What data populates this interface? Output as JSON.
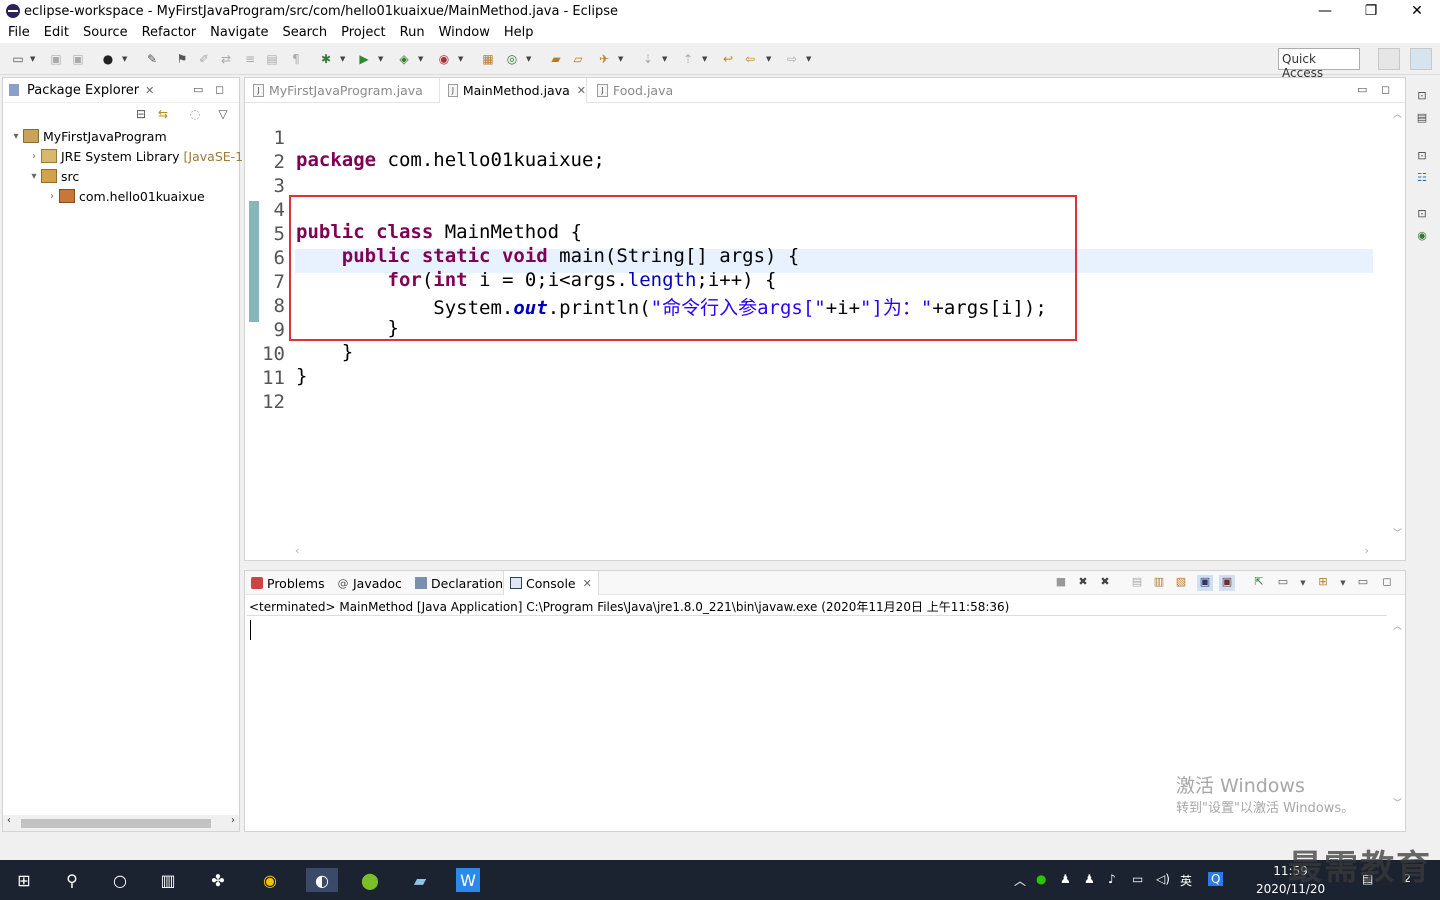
{
  "window": {
    "title": "eclipse-workspace - MyFirstJavaProgram/src/com/hello01kuaixue/MainMethod.java - Eclipse",
    "minimize": "—",
    "restore": "❐",
    "close": "✕"
  },
  "menu": [
    "File",
    "Edit",
    "Source",
    "Refactor",
    "Navigate",
    "Search",
    "Project",
    "Run",
    "Window",
    "Help"
  ],
  "toolbar": {
    "quick_access": "Quick Access"
  },
  "package_explorer": {
    "title": "Package Explorer",
    "tree": [
      {
        "label": "MyFirstJavaProgram",
        "suffix": "",
        "icon": "project-icon",
        "expanded": true
      },
      {
        "label": "JRE System Library",
        "suffix": "[JavaSE-1.",
        "icon": "library-icon",
        "expanded": false
      },
      {
        "label": "src",
        "suffix": "",
        "icon": "source-folder-icon",
        "expanded": true
      },
      {
        "label": "com.hello01kuaixue",
        "suffix": "",
        "icon": "package-icon",
        "expanded": false
      }
    ]
  },
  "editor": {
    "tabs": [
      {
        "label": "MyFirstJavaProgram.java",
        "active": false
      },
      {
        "label": "MainMethod.java",
        "active": true
      },
      {
        "label": "Food.java",
        "active": false
      }
    ],
    "line_numbers": [
      "1",
      "2",
      "3",
      "4",
      "5",
      "6",
      "7",
      "8",
      "9",
      "10",
      "11",
      "12"
    ],
    "current_line": 7,
    "code": {
      "l1_kw": "package",
      "l1_rest": " com.hello01kuaixue;",
      "l4_kw1": "public",
      "l4_kw2": "class",
      "l4_rest": " MainMethod {",
      "l5_indent": "    ",
      "l5_kw1": "public",
      "l5_kw2": "static",
      "l5_kw3": "void",
      "l5_rest": " main(String[] args) {",
      "l6_indent": "        ",
      "l6_kw1": "for",
      "l6_mid1": "(",
      "l6_kw2": "int",
      "l6_mid2": " i = 0;i<args.",
      "l6_fld": "length",
      "l6_rest": ";i++) {",
      "l7_indent": "            ",
      "l7_pre": "System.",
      "l7_fld": "out",
      "l7_mid": ".println(",
      "l7_str1": "\"命令行入参args[\"",
      "l7_mid2": "+i+",
      "l7_str2": "\"]为：\"",
      "l7_rest": "+args[i]);",
      "l8": "        }",
      "l9": "    }",
      "l10": "}"
    }
  },
  "console": {
    "tabs": [
      {
        "label": "Problems"
      },
      {
        "label": "Javadoc"
      },
      {
        "label": "Declaration"
      },
      {
        "label": "Console",
        "active": true
      }
    ],
    "status": "<terminated> MainMethod [Java Application] C:\\Program Files\\Java\\jre1.8.0_221\\bin\\javaw.exe (2020年11月20日 上午11:58:36)"
  },
  "watermark": {
    "line1": "激活 Windows",
    "line2": "转到\"设置\"以激活 Windows。"
  },
  "taskbar": {
    "ime": "英",
    "time": "11:59",
    "date": "2020/11/20",
    "notification_count": "2"
  },
  "brand_overlay": "最需教育",
  "colors": {
    "keyword": "#7f0055",
    "string": "#2a00ff",
    "field": "#0000c0",
    "highlight_box": "#e0303a",
    "current_line": "#e8f2fe",
    "taskbar": "#1b2230"
  }
}
